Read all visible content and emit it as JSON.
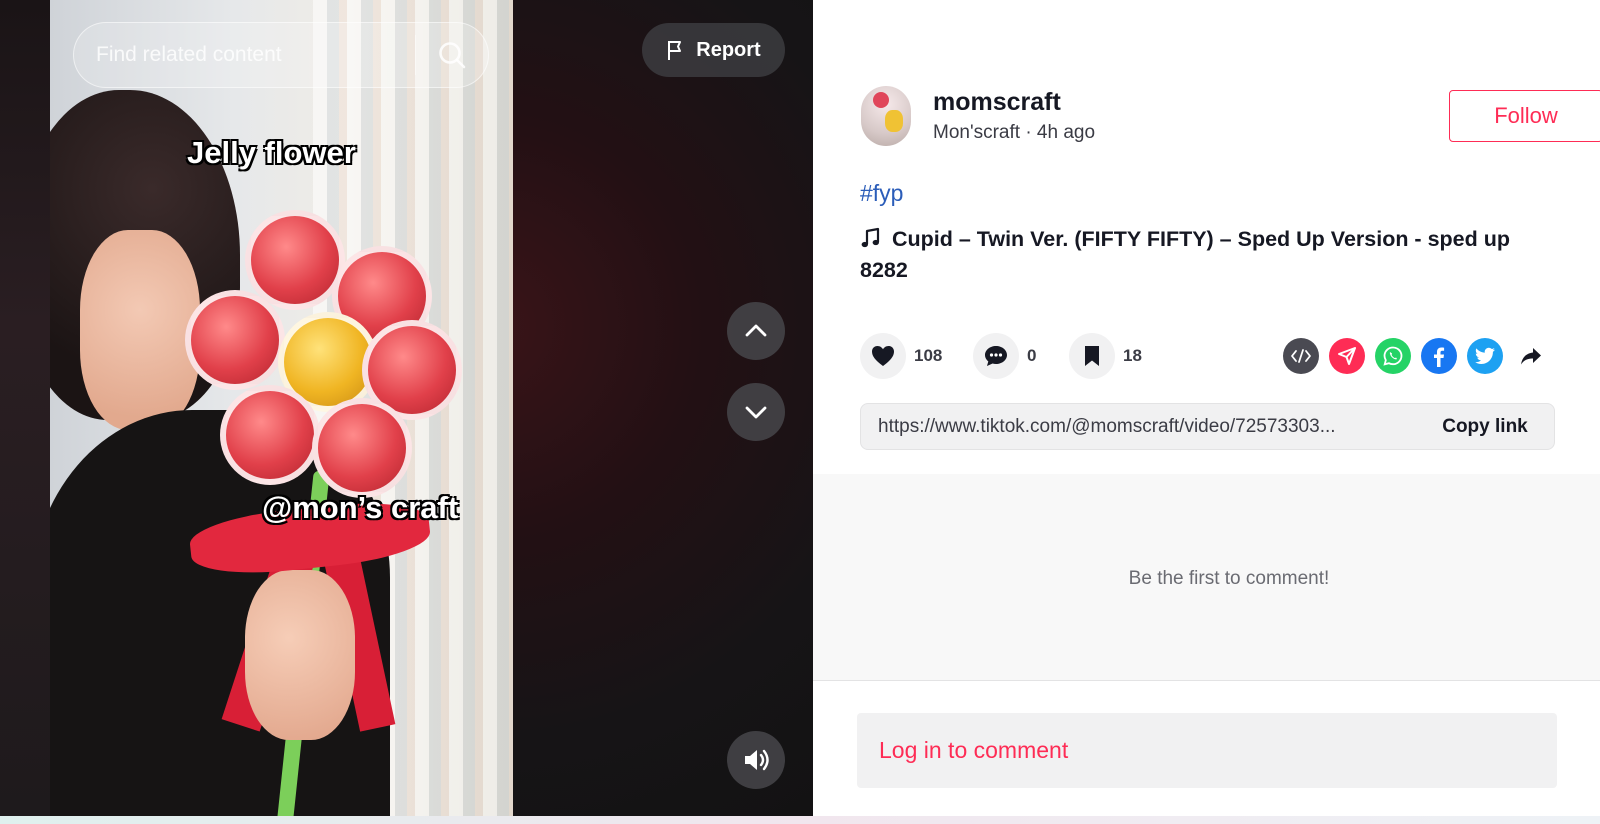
{
  "video": {
    "search_placeholder": "Find related content",
    "report_label": "Report",
    "captions": {
      "top": "Jelly flower",
      "bottom": "@mon’s craft"
    }
  },
  "author": {
    "username": "momscraft",
    "subtitle": "Mon'scraft · 4h ago",
    "follow_label": "Follow"
  },
  "post": {
    "hashtag": "#fyp",
    "music": "Cupid – Twin Ver. (FIFTY FIFTY) – Sped Up Version - sped up 8282"
  },
  "actions": {
    "likes": "108",
    "comments": "0",
    "saves": "18"
  },
  "share_icons": [
    "embed-icon",
    "send-icon",
    "whatsapp-icon",
    "facebook-icon",
    "twitter-icon",
    "share-arrow-icon"
  ],
  "link": {
    "url": "https://www.tiktok.com/@momscraft/video/72573303...",
    "copy_label": "Copy link"
  },
  "comments": {
    "empty_text": "Be the first to comment!",
    "login_label": "Log in to comment"
  },
  "colors": {
    "accent": "#fe2c55",
    "hashtag": "#2b5db9",
    "whatsapp": "#25d366",
    "facebook": "#1877f2",
    "twitter": "#1da1f2"
  }
}
